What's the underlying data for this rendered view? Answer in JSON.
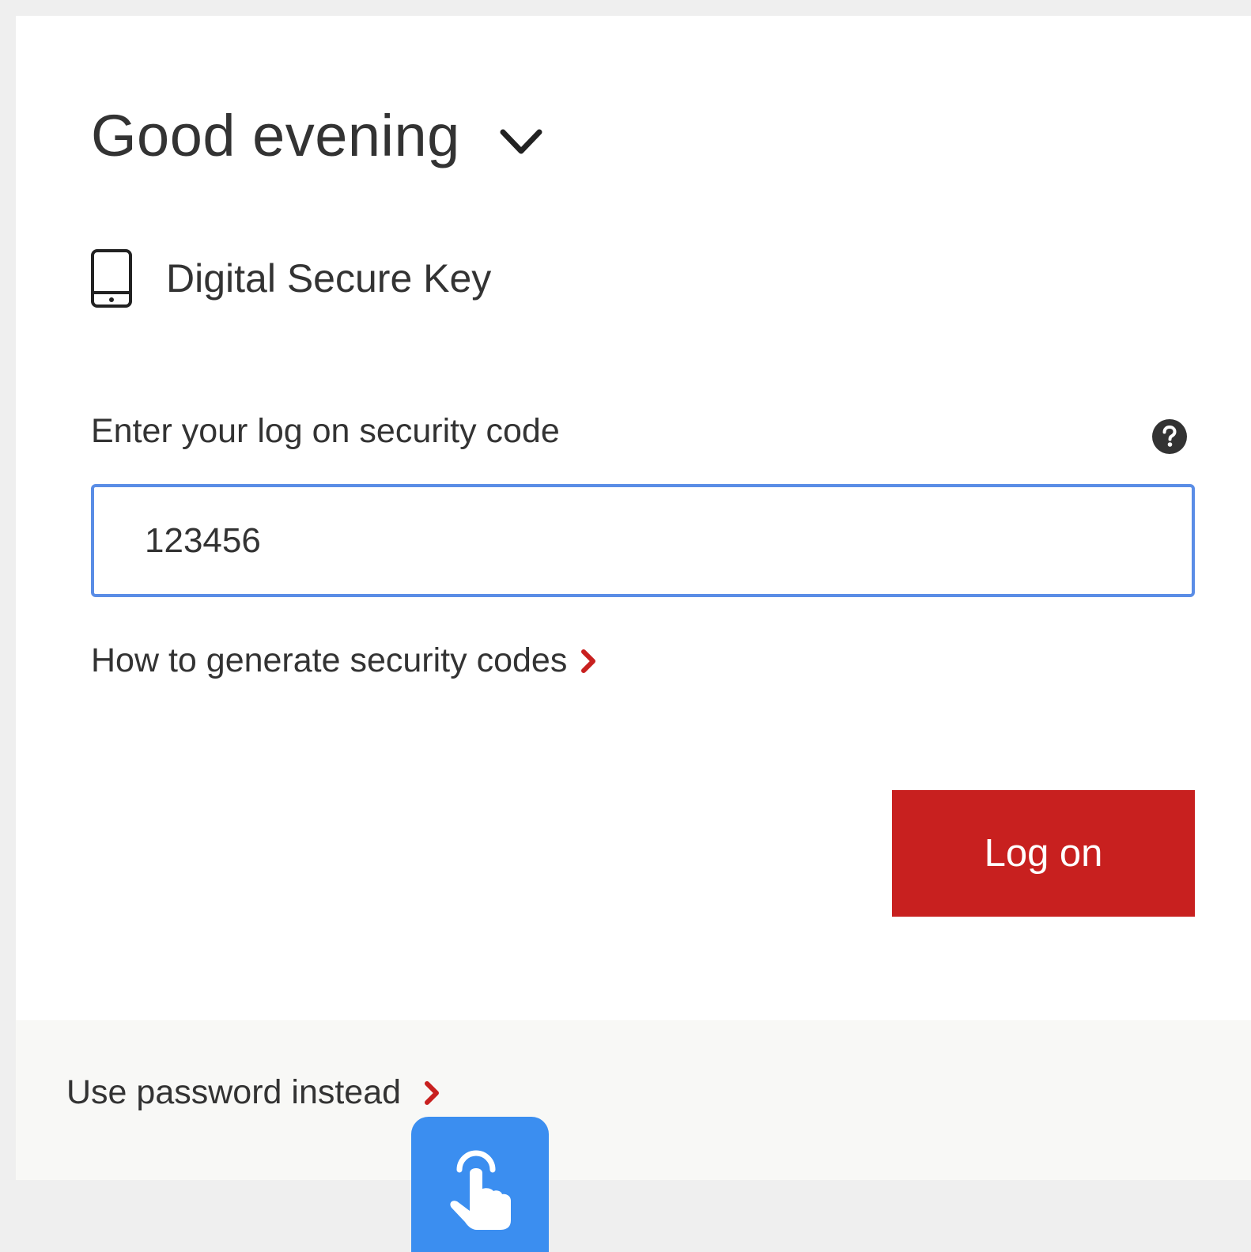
{
  "greeting": {
    "text": "Good evening",
    "toggle_icon": "chevron-down-icon"
  },
  "auth_method": {
    "icon": "mobile-phone-icon",
    "label": "Digital Secure Key"
  },
  "security_code": {
    "label": "Enter your log on security code",
    "help_icon": "question-circle-icon",
    "value": "123456"
  },
  "links": {
    "how_to_generate": "How to generate security codes",
    "use_password": "Use password instead",
    "chevron_icon": "chevron-right-icon"
  },
  "actions": {
    "logon_label": "Log on"
  },
  "overlay": {
    "icon": "touch-gesture-icon"
  },
  "colors": {
    "brand_red": "#c8201f",
    "focus_blue": "#5a8de6",
    "overlay_blue": "#3b8ef0",
    "text": "#333333"
  }
}
